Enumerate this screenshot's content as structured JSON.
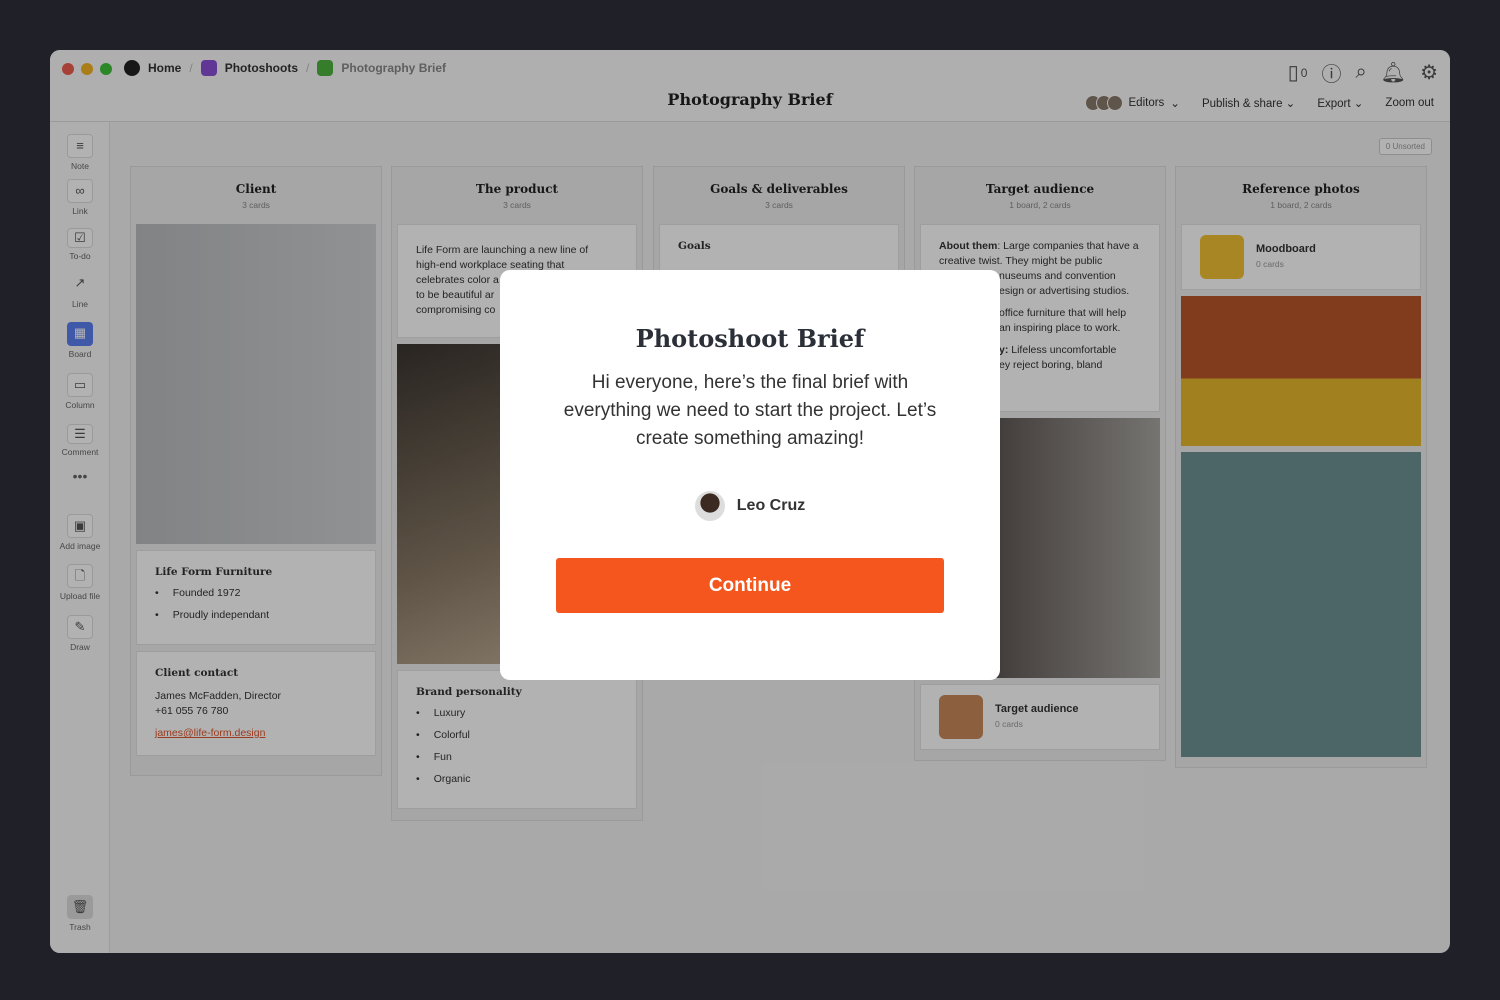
{
  "breadcrumbs": [
    "Home",
    "Photoshoots",
    "Photography Brief"
  ],
  "colors": {
    "home": "#222",
    "photoshoots": "#8a4fd6",
    "brief": "#4db33d",
    "accent": "#f4561d"
  },
  "header": {
    "title": "Photography Brief",
    "device_count": "0",
    "editors": "Editors",
    "publish": "Publish & share",
    "export": "Export",
    "zoom": "Zoom out"
  },
  "sidebar": [
    "Note",
    "Link",
    "To-do",
    "Line",
    "Board",
    "Column",
    "Comment",
    "Add image",
    "Upload file",
    "Draw",
    "Trash"
  ],
  "unsorted": "0 Unsorted",
  "columns": [
    {
      "title": "Client",
      "sub": "3 cards",
      "company": "Life Form Furniture",
      "facts": [
        "Founded 1972",
        "Proudly independant"
      ],
      "contact_title": "Client contact",
      "contact_name": "James McFadden, Director",
      "phone": "+61 055 76 780",
      "email": "james@life-form.design"
    },
    {
      "title": "The product",
      "sub": "3 cards",
      "text": [
        "Life Form are launching a new line of",
        "high-end workplace seating that",
        "celebrates color a",
        "to be beautiful ar",
        "compromising co"
      ],
      "brand_title": "Brand personality",
      "brand": [
        "Luxury",
        "Colorful",
        "Fun",
        "Organic"
      ]
    },
    {
      "title": "Goals & deliverables",
      "sub": "3 cards",
      "goals": "Goals"
    },
    {
      "title": "Target audience",
      "sub": "1 board, 2 cards",
      "about_label": "About them",
      "about": ": Large companies that have a creative twist. They might be public",
      "l3": "nuseums and convention",
      "l4": "esign or advertising studios.",
      "l5": "office furniture that will help",
      "l6": "an inspiring place to work.",
      "l7b": "y:",
      "l7": " Lifeless uncomfortable",
      "l8": "ey reject boring, bland",
      "board": "Target audience",
      "board_sub": "0 cards"
    },
    {
      "title": "Reference photos",
      "sub": "1 board, 2 cards",
      "board": "Moodboard",
      "board_sub": "0 cards"
    }
  ],
  "modal": {
    "title": "Photoshoot Brief",
    "body": "Hi everyone, here’s the final brief with everything we need to start the project. Let’s create something amazing!",
    "author": "Leo Cruz",
    "button": "Continue"
  }
}
